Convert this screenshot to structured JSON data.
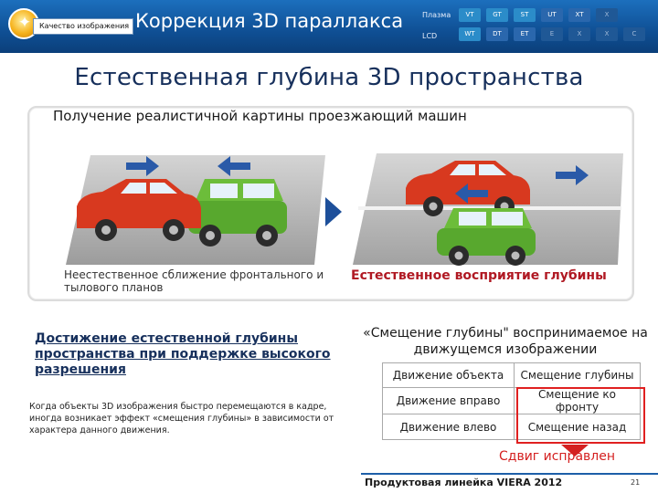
{
  "header": {
    "quality_label": "Качество изображения",
    "title": "Коррекция 3D параллакса",
    "row1_label": "Плазма",
    "row2_label": "LCD",
    "row1_pills": [
      "VT",
      "GT",
      "ST",
      "UT",
      "XT",
      "X"
    ],
    "row2_pills": [
      "WT",
      "DT",
      "ET",
      "E",
      "X",
      "X",
      "C"
    ]
  },
  "slide_title": "Естественная глубина 3D пространства",
  "scene": {
    "title": "Получение реалистичной картины проезжающий машин",
    "left_caption": "Неестественное сближение фронтального и тылового планов",
    "right_caption": "Естественное восприятие глубины"
  },
  "achievement": "Достижение естественной глубины пространства при поддержке высокого разрешения",
  "description": "Когда объекты 3D изображения быстро перемещаются в кадре, иногда возникает эффект «смещения глубины» в зависимости от характера данного движения.",
  "quote": "«Смещение глубины\" воспринимаемое на движущемся изображении",
  "table": {
    "headers": [
      "Движение объекта",
      "Смещение глубины"
    ],
    "rows": [
      [
        "Движение вправо",
        "Смещение ко фронту"
      ],
      [
        "Движение влево",
        "Смещение назад"
      ]
    ]
  },
  "fixed_label": "Сдвиг исправлен",
  "footer": {
    "product_line": "Продуктовая линейка VIERA 2012",
    "page": "21"
  },
  "colors": {
    "header_blue": "#0f4f94",
    "title_navy": "#17305c",
    "accent_red": "#d42020",
    "arrow_blue": "#2a5aa8"
  }
}
